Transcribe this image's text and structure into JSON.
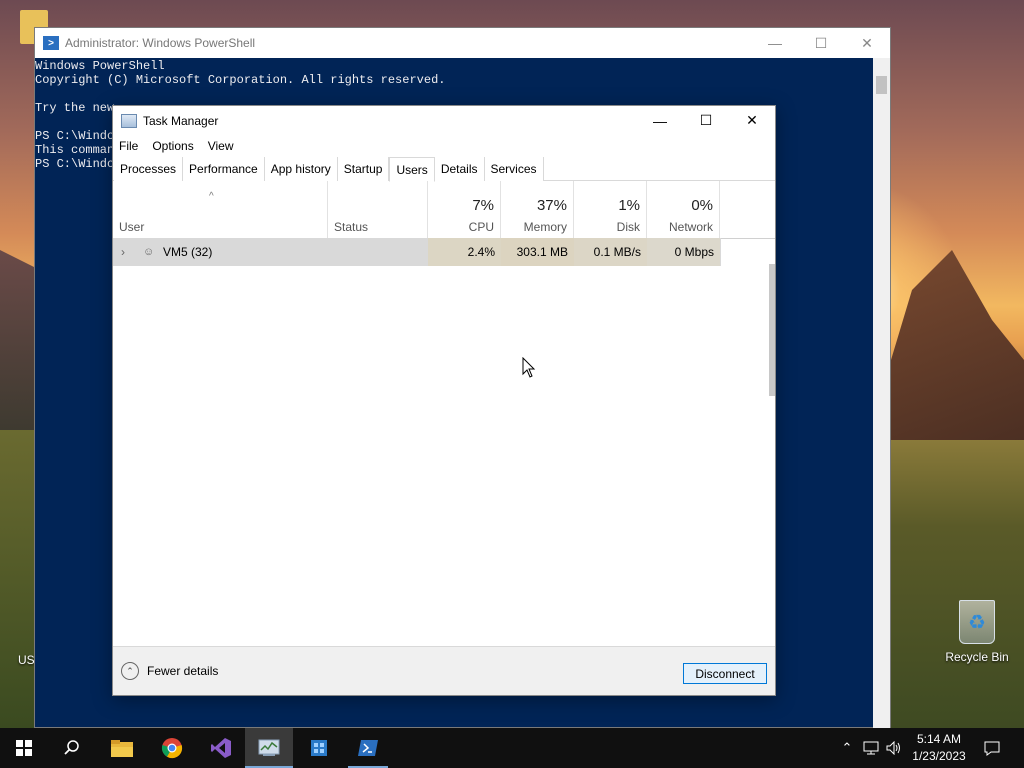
{
  "desktop": {
    "recycle_bin_label": "Recycle Bin",
    "partial_label": "US"
  },
  "powershell": {
    "title": "Administrator: Windows PowerShell",
    "lines": [
      "Windows PowerShell",
      "Copyright (C) Microsoft Corporation. All rights reserved.",
      "",
      "Try the new",
      "",
      "PS C:\\Windo",
      "This comman",
      "PS C:\\Windo"
    ]
  },
  "task_manager": {
    "title": "Task Manager",
    "menu": [
      "File",
      "Options",
      "View"
    ],
    "tabs": [
      "Processes",
      "Performance",
      "App history",
      "Startup",
      "Users",
      "Details",
      "Services"
    ],
    "active_tab": "Users",
    "columns": {
      "user": "User",
      "status": "Status",
      "cpu": {
        "pct": "7%",
        "label": "CPU"
      },
      "memory": {
        "pct": "37%",
        "label": "Memory"
      },
      "disk": {
        "pct": "1%",
        "label": "Disk"
      },
      "network": {
        "pct": "0%",
        "label": "Network"
      }
    },
    "rows": [
      {
        "user": "VM5 (32)",
        "status": "",
        "cpu": "2.4%",
        "memory": "303.1 MB",
        "disk": "0.1 MB/s",
        "network": "0 Mbps"
      }
    ],
    "fewer_details": "Fewer details",
    "disconnect": "Disconnect"
  },
  "taskbar": {
    "time": "5:14 AM",
    "date": "1/23/2023"
  }
}
